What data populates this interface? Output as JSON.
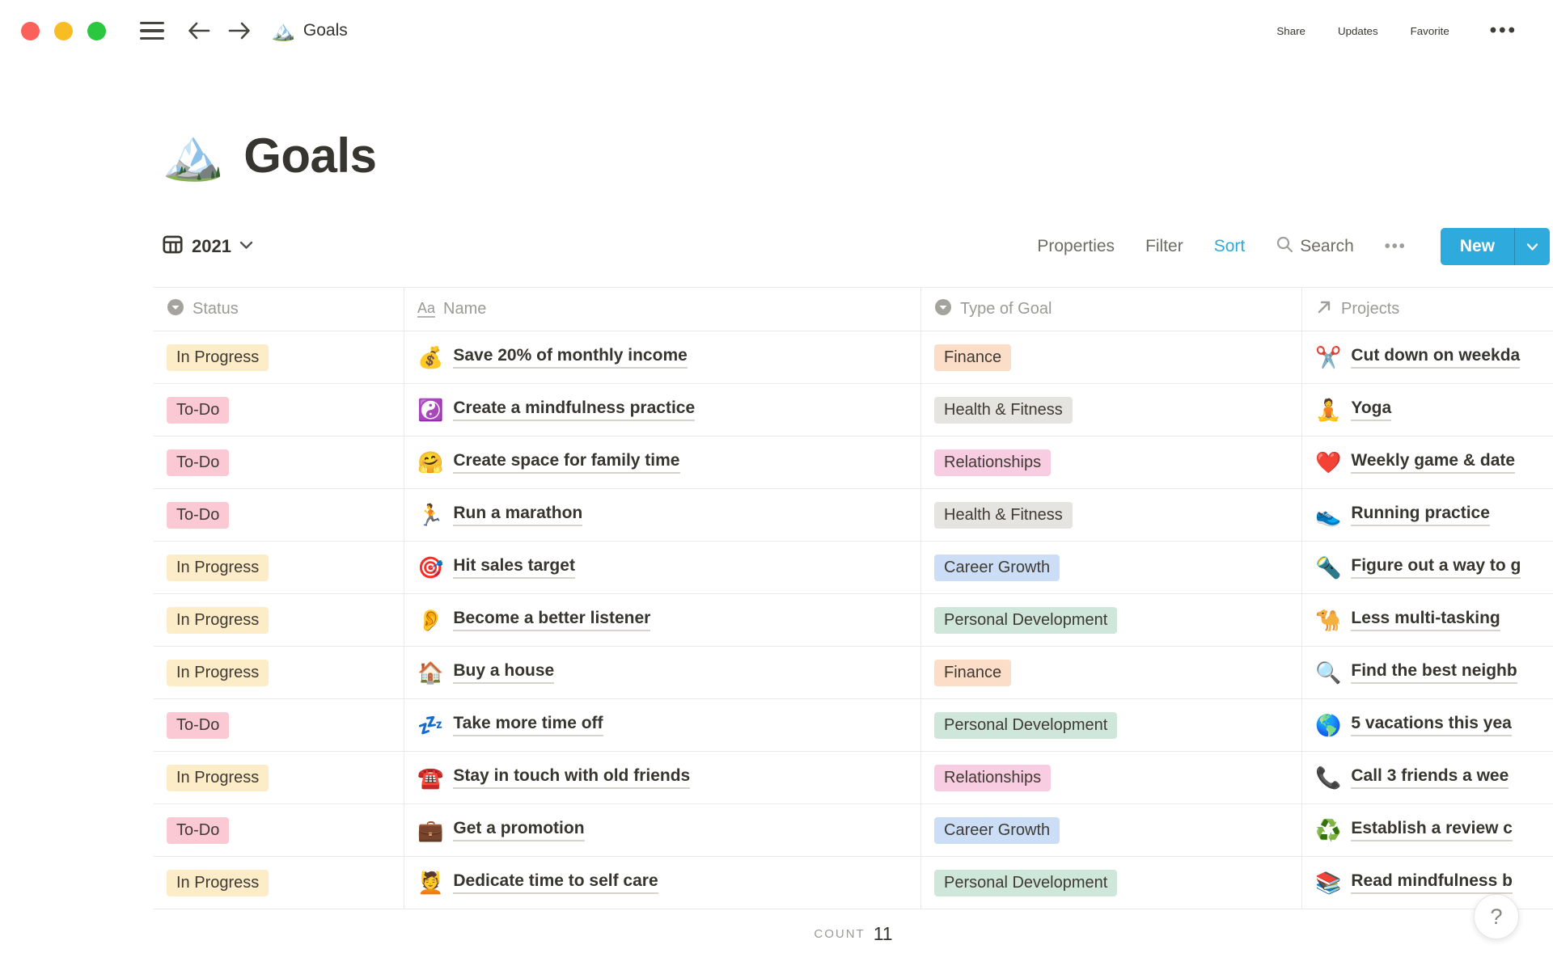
{
  "topbar": {
    "window_controls": [
      "close",
      "minimize",
      "zoom"
    ],
    "doc_icon": "🏔️",
    "doc_title": "Goals",
    "share_label": "Share",
    "updates_label": "Updates",
    "favorite_label": "Favorite",
    "more_icon": "•••"
  },
  "page": {
    "icon": "🏔️",
    "title": "Goals"
  },
  "toolbar": {
    "view_icon": "table-grid",
    "view_name": "2021",
    "properties_label": "Properties",
    "filter_label": "Filter",
    "sort_label": "Sort",
    "search_label": "Search",
    "more_icon": "•••",
    "new_label": "New",
    "accent_color": "#2EAADC"
  },
  "table": {
    "columns": [
      {
        "label": "Status",
        "icon": "select-circle-icon"
      },
      {
        "label": "Name",
        "icon": "Aa"
      },
      {
        "label": "Type of Goal",
        "icon": "select-circle-icon"
      },
      {
        "label": "Projects",
        "icon": "arrow-ne-icon"
      }
    ],
    "status_colors": {
      "In Progress": "#FDECC8",
      "To-Do": "#FBC9D3"
    },
    "type_colors": {
      "Finance": "#FBDDC8",
      "Health & Fitness": "#E5E4E1",
      "Relationships": "#F8CCE1",
      "Career Growth": "#CBDEF6",
      "Personal Development": "#CFE7DA"
    },
    "rows": [
      {
        "status": "In Progress",
        "name_icon": "💰",
        "name": "Save 20% of monthly income",
        "type": "Finance",
        "project_icon": "✂️",
        "project": "Cut down on weekda"
      },
      {
        "status": "To-Do",
        "name_icon": "☯️",
        "name": "Create a mindfulness practice",
        "type": "Health & Fitness",
        "project_icon": "🧘",
        "project": "Yoga"
      },
      {
        "status": "To-Do",
        "name_icon": "🤗",
        "name": "Create space for family time",
        "type": "Relationships",
        "project_icon": "❤️",
        "project": "Weekly game & date"
      },
      {
        "status": "To-Do",
        "name_icon": "🏃",
        "name": "Run a marathon",
        "type": "Health & Fitness",
        "project_icon": "👟",
        "project": "Running practice"
      },
      {
        "status": "In Progress",
        "name_icon": "🎯",
        "name": "Hit sales target",
        "type": "Career Growth",
        "project_icon": "🔦",
        "project": "Figure out a way to g"
      },
      {
        "status": "In Progress",
        "name_icon": "👂",
        "name": "Become a better listener",
        "type": "Personal Development",
        "project_icon": "🐪",
        "project": "Less multi-tasking"
      },
      {
        "status": "In Progress",
        "name_icon": "🏠",
        "name": "Buy a house",
        "type": "Finance",
        "project_icon": "🔍",
        "project": "Find the best neighb"
      },
      {
        "status": "To-Do",
        "name_icon": "💤",
        "name": "Take more time off",
        "type": "Personal Development",
        "project_icon": "🌎",
        "project": "5 vacations this yea"
      },
      {
        "status": "In Progress",
        "name_icon": "☎️",
        "name": "Stay in touch with old friends",
        "type": "Relationships",
        "project_icon": "📞",
        "project": "Call 3 friends a wee"
      },
      {
        "status": "To-Do",
        "name_icon": "💼",
        "name": "Get a promotion",
        "type": "Career Growth",
        "project_icon": "♻️",
        "project": "Establish a review c"
      },
      {
        "status": "In Progress",
        "name_icon": "💆",
        "name": "Dedicate time to self care",
        "type": "Personal Development",
        "project_icon": "📚",
        "project": "Read mindfulness b"
      }
    ],
    "count_label": "COUNT",
    "count_value": "11"
  },
  "help": {
    "label": "?"
  }
}
